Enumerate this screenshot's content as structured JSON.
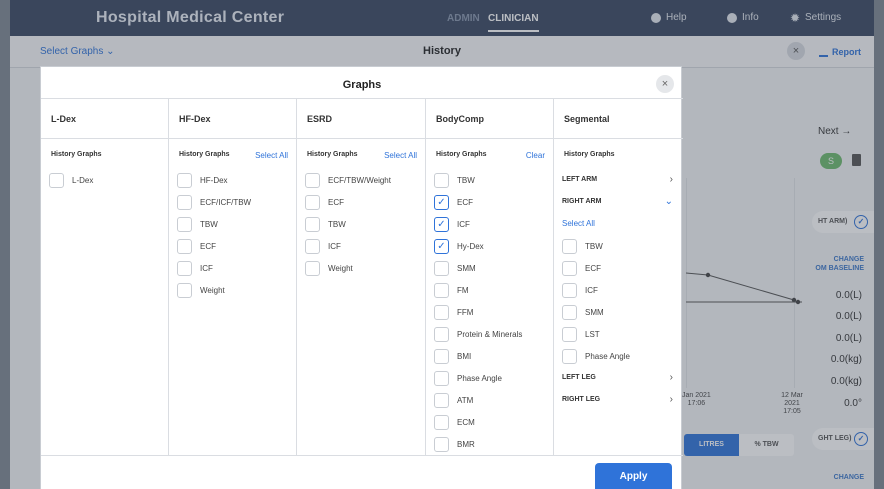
{
  "app": {
    "brand": "Hospital Medical Center",
    "roles": [
      "ADMIN",
      "CLINICIAN"
    ],
    "top_actions": [
      {
        "label": "Help",
        "icon": "globe-icon"
      },
      {
        "label": "Info",
        "icon": "info-icon"
      },
      {
        "label": "Settings",
        "icon": "gear-icon"
      }
    ]
  },
  "history": {
    "select_graphs": "Select Graphs",
    "title": "History",
    "close": "×",
    "report": "Report",
    "next": "Next →",
    "badge": "S",
    "right_arm_tab": "HT ARM)",
    "right_leg_tab": "GHT LEG)",
    "change_baseline_1": [
      "CHANGE",
      "OM BASELINE"
    ],
    "change_baseline_2": [
      "CHANGE"
    ],
    "values": [
      "0.0(L)",
      "0.0(L)",
      "0.0(L)",
      "0.0(kg)",
      "0.0(kg)",
      "0.0°"
    ],
    "dates": [
      [
        "Jan 2021",
        "17:06"
      ],
      [
        "12 Mar 2021",
        "17:05"
      ]
    ],
    "unit_toggle": [
      "LITRES",
      "% TBW"
    ]
  },
  "modal": {
    "title": "Graphs",
    "close": "×",
    "apply": "Apply",
    "columns": [
      {
        "heading": "L-Dex",
        "subheading": "History Graphs",
        "action": "",
        "items": [
          {
            "label": "L-Dex",
            "checked": false
          }
        ]
      },
      {
        "heading": "HF-Dex",
        "subheading": "History Graphs",
        "action": "Select All",
        "items": [
          {
            "label": "HF-Dex",
            "checked": false
          },
          {
            "label": "ECF/ICF/TBW",
            "checked": false
          },
          {
            "label": "TBW",
            "checked": false
          },
          {
            "label": "ECF",
            "checked": false
          },
          {
            "label": "ICF",
            "checked": false
          },
          {
            "label": "Weight",
            "checked": false
          }
        ]
      },
      {
        "heading": "ESRD",
        "subheading": "History Graphs",
        "action": "Select All",
        "items": [
          {
            "label": "ECF/TBW/Weight",
            "checked": false
          },
          {
            "label": "ECF",
            "checked": false
          },
          {
            "label": "TBW",
            "checked": false
          },
          {
            "label": "ICF",
            "checked": false
          },
          {
            "label": "Weight",
            "checked": false
          }
        ]
      },
      {
        "heading": "BodyComp",
        "subheading": "History Graphs",
        "action": "Clear",
        "items": [
          {
            "label": "TBW",
            "checked": false
          },
          {
            "label": "ECF",
            "checked": true
          },
          {
            "label": "ICF",
            "checked": true
          },
          {
            "label": "Hy-Dex",
            "checked": true
          },
          {
            "label": "SMM",
            "checked": false
          },
          {
            "label": "FM",
            "checked": false
          },
          {
            "label": "FFM",
            "checked": false
          },
          {
            "label": "Protein & Minerals",
            "checked": false
          },
          {
            "label": "BMI",
            "checked": false
          },
          {
            "label": "Phase Angle",
            "checked": false
          },
          {
            "label": "ATM",
            "checked": false
          },
          {
            "label": "ECM",
            "checked": false
          },
          {
            "label": "BMR",
            "checked": false
          }
        ]
      }
    ],
    "segmental": {
      "heading": "Segmental",
      "subheading": "History Graphs",
      "left_arm": "LEFT ARM",
      "right_arm": "RIGHT ARM",
      "select_all": "Select All",
      "right_arm_items": [
        "TBW",
        "ECF",
        "ICF",
        "SMM",
        "LST",
        "Phase Angle"
      ],
      "left_leg": "LEFT LEG",
      "right_leg": "RIGHT LEG"
    }
  },
  "colors": {
    "accent": "#2f73d9",
    "topbar": "#394862",
    "badge": "#6dbb6d"
  }
}
